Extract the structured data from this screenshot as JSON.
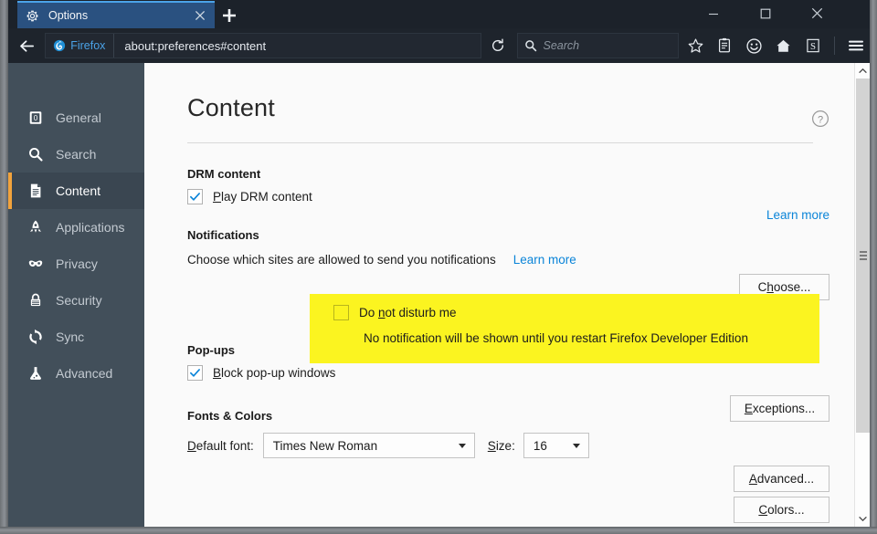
{
  "window": {
    "controls": {
      "minimize": "minimize-button",
      "maximize": "maximize-button",
      "close": "close-button"
    }
  },
  "tabbar": {
    "tab_title": "Options",
    "tab_favicon": "gear-icon",
    "close_label": "close-tab-icon",
    "newtab_label": "new-tab-icon"
  },
  "navbar": {
    "back_icon": "back-arrow-icon",
    "identity_label": "Firefox",
    "url": "about:preferences#content",
    "reload_icon": "reload-icon",
    "search_placeholder": "Search",
    "search_icon": "search-icon",
    "icons": [
      "bookmark-star-icon",
      "reader-list-icon",
      "smiley-feedback-icon",
      "home-icon",
      "screenshot-s-icon"
    ],
    "menu_icon": "hamburger-menu-icon"
  },
  "sidebar": {
    "items": [
      {
        "label": "General",
        "icon": "general-icon",
        "active": false
      },
      {
        "label": "Search",
        "icon": "search-icon",
        "active": false
      },
      {
        "label": "Content",
        "icon": "content-page-icon",
        "active": true
      },
      {
        "label": "Applications",
        "icon": "rocket-icon",
        "active": false
      },
      {
        "label": "Privacy",
        "icon": "mask-icon",
        "active": false
      },
      {
        "label": "Security",
        "icon": "lock-icon",
        "active": false
      },
      {
        "label": "Sync",
        "icon": "sync-icon",
        "active": false
      },
      {
        "label": "Advanced",
        "icon": "flask-icon",
        "active": false
      }
    ]
  },
  "main": {
    "title": "Content",
    "help_icon": "help-question-icon",
    "drm": {
      "heading": "DRM content",
      "checkbox_label": "Play DRM content",
      "checkbox_accesskey": "P",
      "checked": true,
      "learn_more": "Learn more"
    },
    "notifications": {
      "heading": "Notifications",
      "description": "Choose which sites are allowed to send you notifications",
      "learn_more": "Learn more",
      "choose_button": "Choose...",
      "choose_accesskey": "h",
      "dnd_label": "Do not disturb me",
      "dnd_accesskey": "n",
      "dnd_checked": false,
      "dnd_note": "No notification will be shown until you restart Firefox Developer Edition",
      "highlight_color": "#fbf420"
    },
    "popups": {
      "heading": "Pop-ups",
      "checkbox_label": "Block pop-up windows",
      "checkbox_accesskey": "B",
      "checked": true,
      "exceptions_button": "Exceptions...",
      "exceptions_accesskey": "E"
    },
    "fonts": {
      "heading": "Fonts & Colors",
      "font_label": "Default font:",
      "font_accesskey": "D",
      "font_value": "Times New Roman",
      "size_label": "Size:",
      "size_accesskey": "S",
      "size_value": "16",
      "advanced_button": "Advanced...",
      "advanced_accesskey": "A",
      "colors_button": "Colors...",
      "colors_accesskey": "C"
    }
  },
  "scrollbar": {
    "up_icon": "chevron-up-icon",
    "down_icon": "chevron-down-icon",
    "grip_icon": "scrollbar-grip-icon"
  },
  "colors": {
    "accent_orange": "#f2a33c",
    "link_blue": "#0a84d8",
    "tab_blue": "#2a5180",
    "tab_top_blue": "#4ba3e8",
    "sidebar_bg": "#424f5a",
    "highlight_yellow": "#fbf420"
  }
}
